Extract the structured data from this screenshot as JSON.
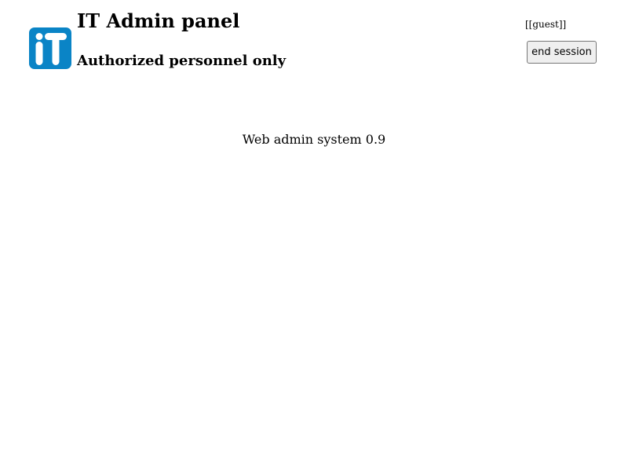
{
  "header": {
    "logo_icon": "it-logo-icon",
    "logo_text": "iT",
    "logo_color": "#0a84c6",
    "title": "IT Admin panel",
    "subtitle": "Authorized personnel only"
  },
  "user": {
    "label": "[[guest]]",
    "end_session_label": "end session"
  },
  "main": {
    "system_version": "Web admin system 0.9"
  }
}
